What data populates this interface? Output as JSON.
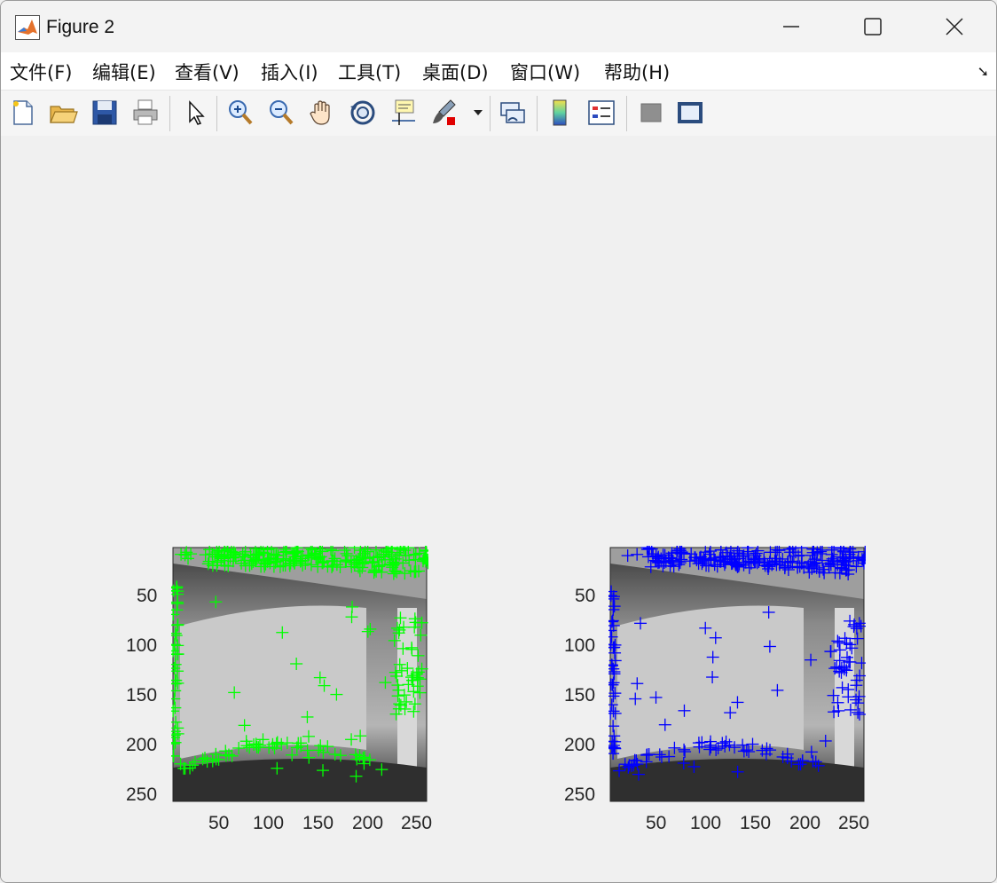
{
  "window": {
    "title": "Figure 2"
  },
  "menu": {
    "items": [
      {
        "label": "文件(F)"
      },
      {
        "label": "编辑(E)"
      },
      {
        "label": "查看(V)"
      },
      {
        "label": "插入(I)"
      },
      {
        "label": "工具(T)"
      },
      {
        "label": "桌面(D)"
      },
      {
        "label": "窗口(W)"
      },
      {
        "label": "帮助(H)"
      }
    ]
  },
  "toolbar": {
    "icons": [
      "new-figure-icon",
      "open-file-icon",
      "save-icon",
      "print-icon",
      "edit-plot-arrow-icon",
      "zoom-in-icon",
      "zoom-out-icon",
      "pan-hand-icon",
      "rotate-3d-icon",
      "data-cursor-icon",
      "brush-icon",
      "link-plot-icon",
      "colorbar-icon",
      "legend-icon",
      "hide-plot-tools-icon",
      "show-plot-tools-icon"
    ]
  },
  "axes": [
    {
      "name": "left",
      "marker_color": "#00ff00",
      "xticks": [
        "50",
        "100",
        "150",
        "200",
        "250"
      ],
      "yticks": [
        "50",
        "100",
        "150",
        "200",
        "250"
      ]
    },
    {
      "name": "right",
      "marker_color": "#0000ff",
      "xticks": [
        "50",
        "100",
        "150",
        "200",
        "250"
      ],
      "yticks": [
        "50",
        "100",
        "150",
        "200",
        "250"
      ]
    }
  ]
}
